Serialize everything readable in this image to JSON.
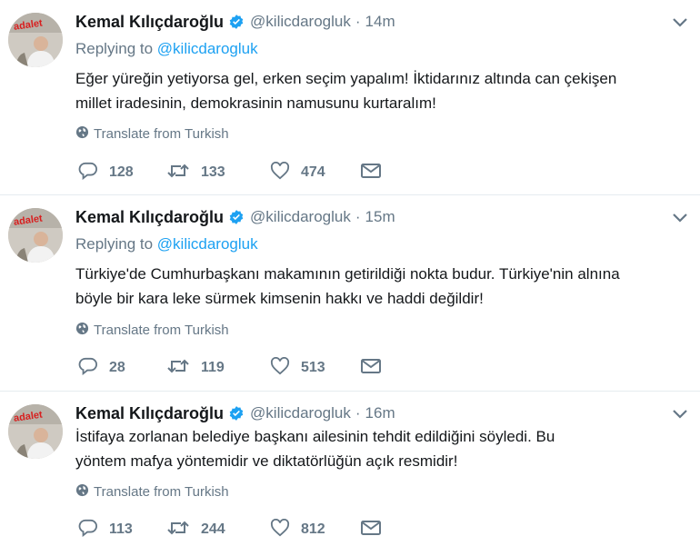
{
  "tweets": [
    {
      "author_name": "Kemal Kılıçdaroğlu",
      "handle": "@kilicdarogluk",
      "separator": "·",
      "time": "14m",
      "replying_prefix": "Replying to ",
      "replying_handle": "@kilicdarogluk",
      "text_lines": [
        "Eğer yüreğin yetiyorsa gel, erken seçim yapalım! İktidarınız altında can çekişen",
        "millet iradesinin, demokrasinin namusunu kurtaralım!"
      ],
      "translate_label": "Translate from Turkish",
      "replies": "128",
      "retweets": "133",
      "likes": "474"
    },
    {
      "author_name": "Kemal Kılıçdaroğlu",
      "handle": "@kilicdarogluk",
      "separator": "·",
      "time": "15m",
      "replying_prefix": "Replying to ",
      "replying_handle": "@kilicdarogluk",
      "text_lines": [
        "Türkiye'de Cumhurbaşkanı makamının getirildiği nokta budur. Türkiye'nin alnına",
        "böyle bir kara leke sürmek kimsenin hakkı ve haddi değildir!"
      ],
      "translate_label": "Translate from Turkish",
      "replies": "28",
      "retweets": "119",
      "likes": "513"
    },
    {
      "author_name": "Kemal Kılıçdaroğlu",
      "handle": "@kilicdarogluk",
      "separator": "·",
      "time": "16m",
      "text_lines": [
        "İstifaya zorlanan belediye başkanı ailesinin tehdit edildiğini söyledi. Bu",
        "yöntem mafya yöntemidir ve diktatörlüğün açık resmidir!"
      ],
      "translate_label": "Translate from Turkish",
      "replies": "113",
      "retweets": "244",
      "likes": "812"
    }
  ],
  "avatar_logo_text": "adalet",
  "icons": {
    "verified": "verified-badge-icon",
    "caret": "chevron-down-icon",
    "globe": "globe-icon",
    "reply": "reply-icon",
    "retweet": "retweet-icon",
    "like": "heart-icon",
    "dm": "envelope-icon"
  },
  "colors": {
    "link": "#1da1f2",
    "muted": "#657786",
    "text": "#14171a",
    "logo_red": "#d81e1e"
  }
}
